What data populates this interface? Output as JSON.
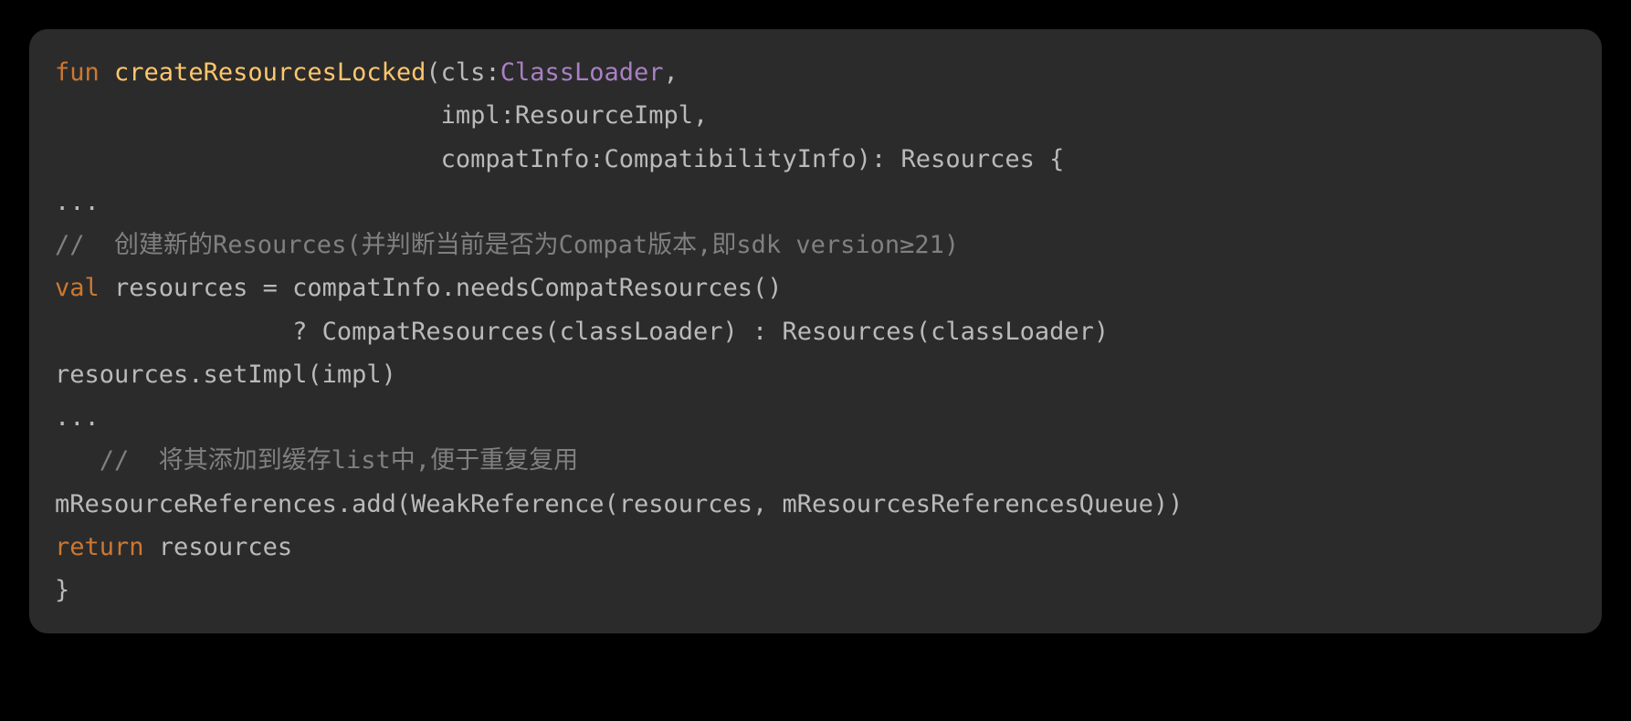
{
  "code": {
    "line1_fun": "fun",
    "line1_func": " createResourcesLocked",
    "line1_paren": "(cls:",
    "line1_type": "ClassLoader",
    "line1_comma": ",",
    "line2": "                          impl:ResourceImpl,",
    "line3": "                          compatInfo:CompatibilityInfo): Resources {",
    "line4": "...",
    "line5": "//  创建新的Resources(并判断当前是否为Compat版本,即sdk version≥21)",
    "line6_val": "val",
    "line6_rest": " resources = compatInfo.needsCompatResources()",
    "line7": "                ? CompatResources(classLoader) : Resources(classLoader)",
    "line8": "resources.setImpl(impl)",
    "line9": "...",
    "line10": "   //  将其添加到缓存list中,便于重复复用",
    "line11": "mResourceReferences.add(WeakReference(resources, mResourcesReferencesQueue))",
    "line12_return": "return",
    "line12_rest": " resources",
    "line13": "}"
  }
}
